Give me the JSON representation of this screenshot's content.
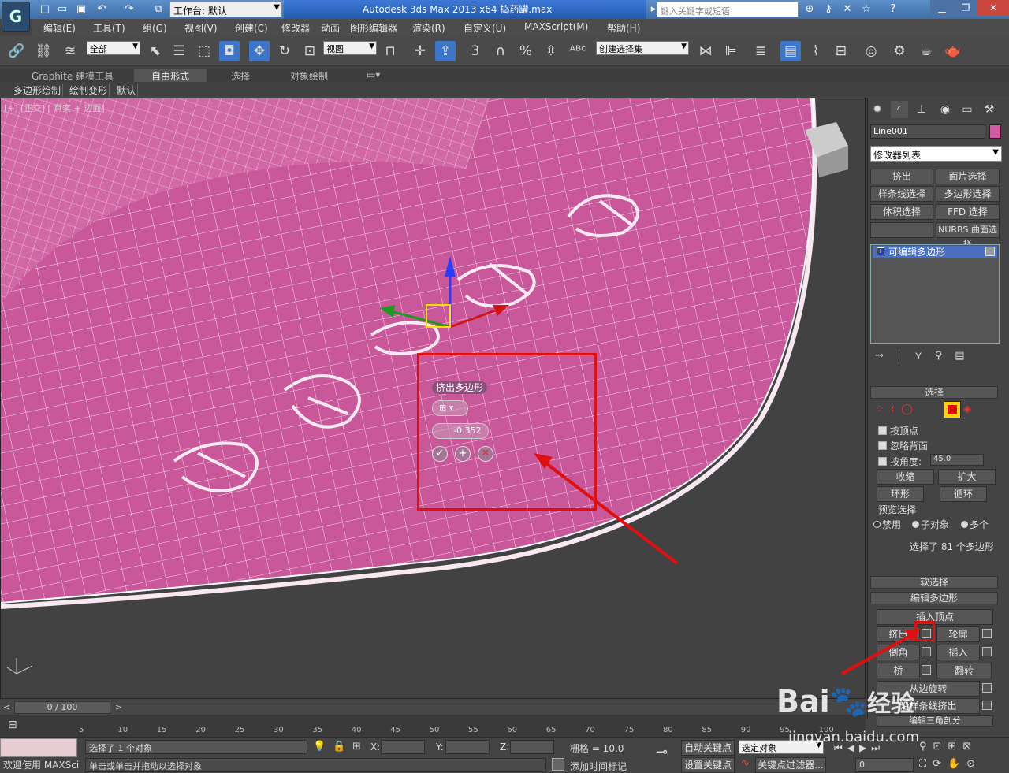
{
  "titlebar": {
    "app_title": "Autodesk 3ds Max  2013 x64     捣药罐.max",
    "workspace_label": "工作台: 默认",
    "search_placeholder": "键入关键字或短语",
    "logo": "G"
  },
  "menubar": {
    "items": [
      "编辑(E)",
      "工具(T)",
      "组(G)",
      "视图(V)",
      "创建(C)",
      "修改器",
      "动画",
      "图形编辑器",
      "渲染(R)",
      "自定义(U)",
      "MAXScript(M)",
      "帮助(H)"
    ]
  },
  "toolbar": {
    "filter_value": "全部",
    "refcoord_value": "视图",
    "snap_numbers": [
      "3",
      "%"
    ],
    "selection_set_placeholder": "创建选择集"
  },
  "ribbon": {
    "tabs": [
      "Graphite 建模工具",
      "自由形式",
      "选择",
      "对象绘制"
    ],
    "subtabs": [
      "多边形绘制",
      "绘制变形",
      "默认"
    ]
  },
  "viewport": {
    "label": "[+] [正交] [ 真实 + 边面]"
  },
  "caddy": {
    "title": "挤出多边形",
    "type_value": "⊞ ▾",
    "height_value": "-0.352",
    "ok": "✓",
    "apply": "+",
    "cancel": "✕"
  },
  "command_panel": {
    "object_name": "Line001",
    "object_color": "#d25aa0",
    "modifier_list": "修改器列表",
    "modifier_buttons": [
      "挤出",
      "面片选择",
      "样条线选择",
      "多边形选择",
      "体积选择",
      "FFD 选择",
      "",
      "NURBS 曲面选择"
    ],
    "stack_item": "可编辑多边形",
    "selection": {
      "header": "选择",
      "by_vertex": "按顶点",
      "ignore_backface": "忽略背面",
      "by_angle": "按角度:",
      "angle_value": "45.0",
      "shrink": "收缩",
      "grow": "扩大",
      "ring": "环形",
      "loop": "循环",
      "preview_label": "预览选择",
      "preview_options": [
        "禁用",
        "子对象",
        "多个"
      ],
      "status": "选择了 81 个多边形"
    },
    "soft_selection": "软选择",
    "edit_polygons": {
      "header": "编辑多边形",
      "insert_vertex": "插入顶点",
      "extrude": "挤出",
      "outline": "轮廓",
      "bevel": "倒角",
      "inset": "插入",
      "bridge": "桥",
      "flip": "翻转",
      "hinge": "从边旋转",
      "extrude_along": "沿样条线挤出",
      "edit_tri": "编辑三角剖分"
    }
  },
  "timeline": {
    "frame_label": "0 / 100",
    "ticks": [
      "5",
      "10",
      "15",
      "20",
      "25",
      "30",
      "35",
      "40",
      "45",
      "50",
      "55",
      "60",
      "65",
      "70",
      "75",
      "80",
      "85",
      "90",
      "95",
      "100"
    ]
  },
  "status": {
    "welcome": "欢迎使用 MAXSci",
    "selected": "选择了 1 个对象",
    "prompt": "单击或单击并拖动以选择对象",
    "x_label": "X:",
    "y_label": "Y:",
    "z_label": "Z:",
    "grid": "栅格 = 10.0",
    "auto_key": "自动关键点",
    "set_key": "设置关键点",
    "selected_object": "选定对象",
    "key_filter": "关键点过滤器...",
    "add_time_tag": "添加时间标记",
    "frame_value": "0"
  },
  "watermark": {
    "brand": "Bai",
    "brand2": "经验",
    "url": "jingyan.baidu.com"
  }
}
